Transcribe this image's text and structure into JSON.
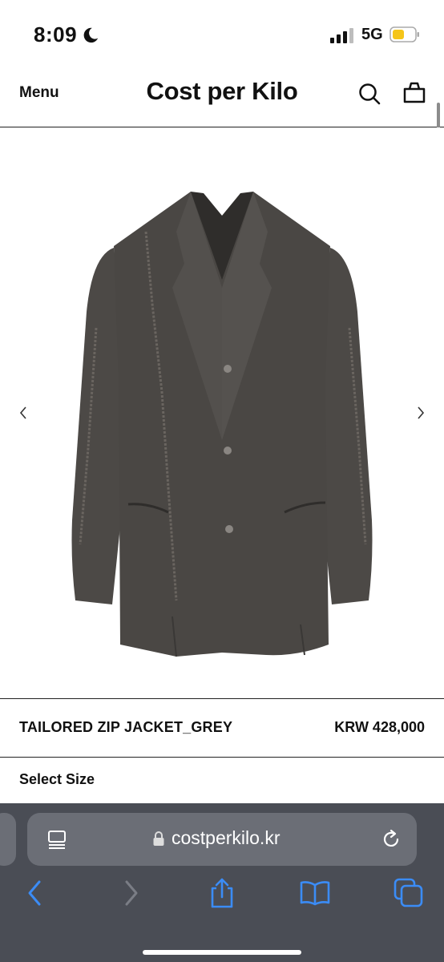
{
  "status_bar": {
    "time": "8:09",
    "network": "5G"
  },
  "header": {
    "menu_label": "Menu",
    "brand": "Cost per Kilo"
  },
  "product": {
    "name": "TAILORED ZIP JACKET_GREY",
    "price": "KRW 428,000",
    "select_size_label": "Select Size",
    "image_color": "#4a4744"
  },
  "browser": {
    "url": "costperkilo.kr"
  },
  "colors": {
    "accent_blue": "#3b8cf6",
    "battery_yellow": "#f5c518"
  }
}
